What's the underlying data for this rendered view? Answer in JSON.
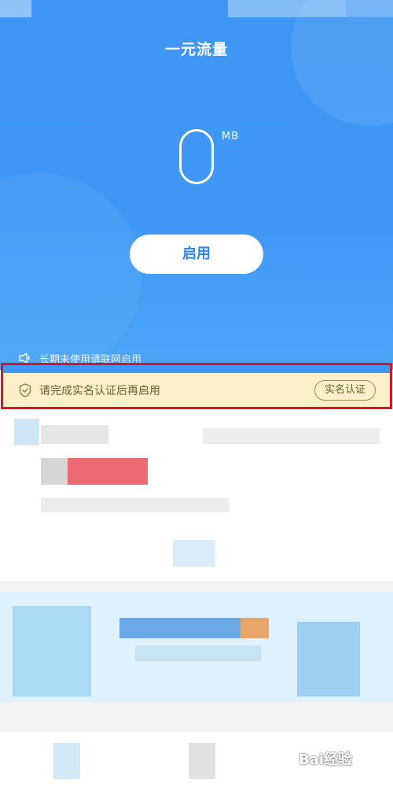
{
  "header": {
    "title": "一元流量"
  },
  "usage": {
    "value": "0",
    "unit": "MB"
  },
  "actions": {
    "enable_label": "启用"
  },
  "hint": {
    "text": "长期未使用请联网启用"
  },
  "notice": {
    "text": "请完成实名认证后再启用",
    "verify_label": "实名认证"
  },
  "watermark": {
    "text": "Bai经验"
  },
  "colors": {
    "primary_blue": "#3f98f6",
    "notice_bg": "#fbf0c7",
    "highlight_border": "#d6171f"
  }
}
